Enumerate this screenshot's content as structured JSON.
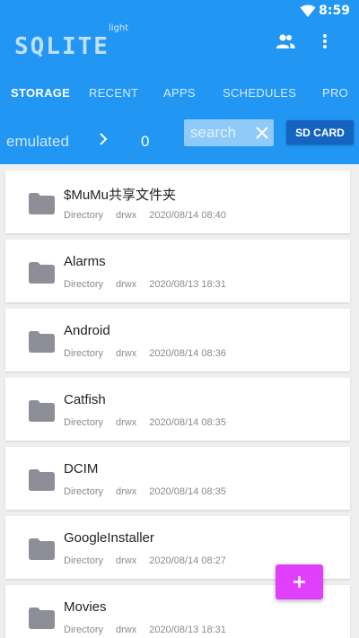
{
  "status_bar": {
    "time": "8:59"
  },
  "app": {
    "logo_text": "SQLITE",
    "logo_sub": "light"
  },
  "tabs": [
    {
      "label": "STORAGE",
      "active": true
    },
    {
      "label": "RECENT",
      "active": false
    },
    {
      "label": "APPS",
      "active": false
    },
    {
      "label": "SCHEDULES",
      "active": false
    },
    {
      "label": "PRO",
      "active": false
    }
  ],
  "path": {
    "current": "emulated",
    "count": "0"
  },
  "search": {
    "placeholder": "search"
  },
  "sd_card_label": "SD CARD",
  "files": [
    {
      "name": "$MuMu共享文件夹",
      "type": "Directory",
      "perm": "drwx",
      "date": "2020/08/14 08:40"
    },
    {
      "name": "Alarms",
      "type": "Directory",
      "perm": "drwx",
      "date": "2020/08/13 18:31"
    },
    {
      "name": "Android",
      "type": "Directory",
      "perm": "drwx",
      "date": "2020/08/14 08:36"
    },
    {
      "name": "Catfish",
      "type": "Directory",
      "perm": "drwx",
      "date": "2020/08/14 08:35"
    },
    {
      "name": "DCIM",
      "type": "Directory",
      "perm": "drwx",
      "date": "2020/08/14 08:35"
    },
    {
      "name": "GoogleInstaller",
      "type": "Directory",
      "perm": "drwx",
      "date": "2020/08/14 08:27"
    },
    {
      "name": "Movies",
      "type": "Directory",
      "perm": "drwx",
      "date": "2020/08/13 18:31"
    }
  ],
  "colors": {
    "primary": "#2196f3",
    "accent": "#e040fb",
    "folder": "#8e8e98"
  },
  "icons": {
    "people": "people-icon",
    "more": "more-vert-icon",
    "add": "plus-icon",
    "folder": "folder-icon"
  }
}
